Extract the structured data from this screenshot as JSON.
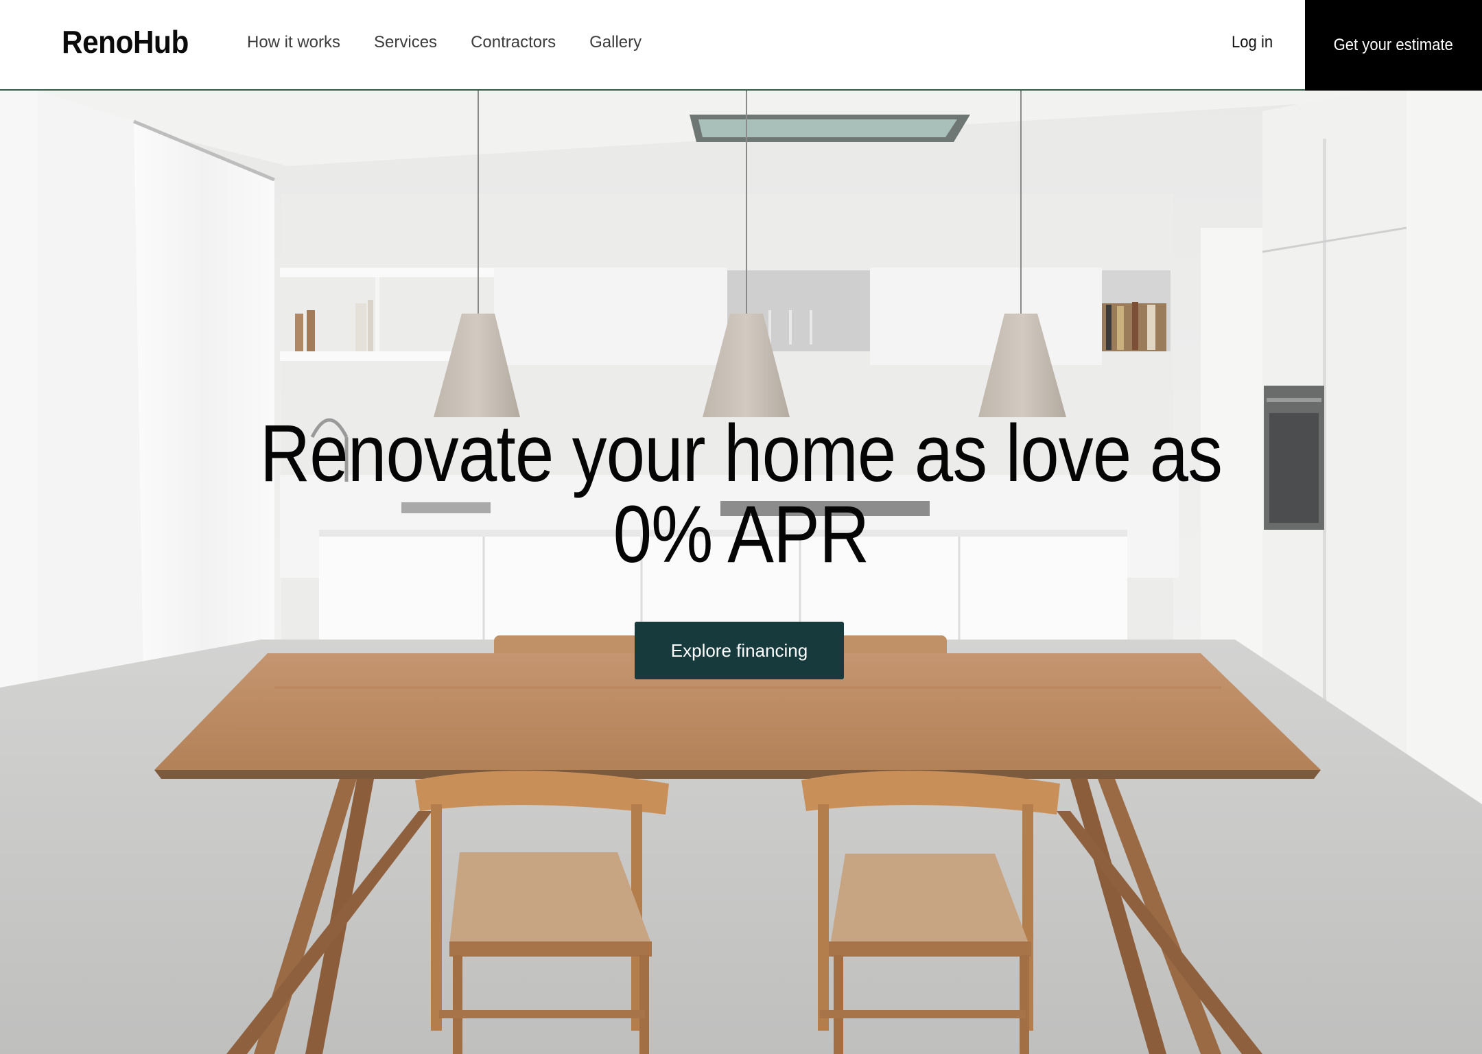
{
  "header": {
    "logo": "RenoHub",
    "nav": [
      {
        "label": "How it works"
      },
      {
        "label": "Services"
      },
      {
        "label": "Contractors"
      },
      {
        "label": "Gallery"
      }
    ],
    "login_label": "Log in",
    "estimate_label": "Get your estimate"
  },
  "hero": {
    "title_line1": "Renovate your home as love as",
    "title_line2": "0% APR",
    "cta_label": "Explore financing",
    "image": "kitchen-photo"
  },
  "colors": {
    "accent": "#173b3d",
    "nav_border": "#2f5b47",
    "estimate_bg": "#000000"
  }
}
